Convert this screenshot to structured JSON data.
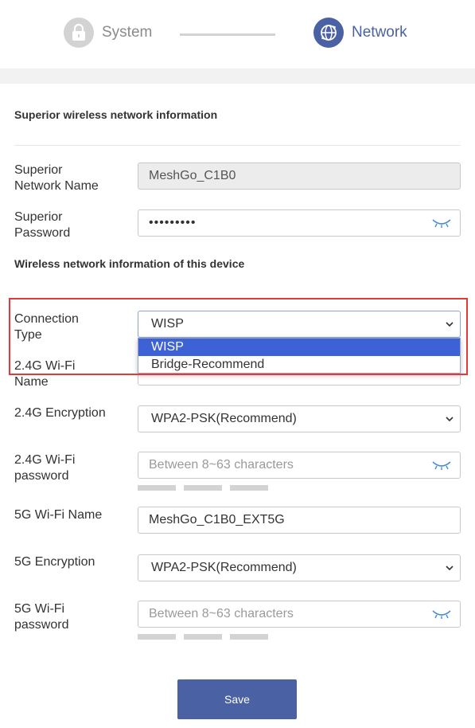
{
  "stepper": {
    "step1_label": "System",
    "step1_icon": "lock-icon",
    "step2_label": "Network",
    "step2_icon": "globe-network-icon",
    "active_color": "#4a62a4",
    "inactive_color": "#d3d3d3"
  },
  "superior": {
    "section_title": "Superior wireless network information",
    "network_name_label_1": "Superior",
    "network_name_label_2": "Network Name",
    "network_name_value": "MeshGo_C1B0",
    "password_label_1": "Superior",
    "password_label_2": "Password",
    "password_value": "•••••••••"
  },
  "device": {
    "section_title": "Wireless network information of this device",
    "connection_type_label_1": "Connection",
    "connection_type_label_2": "Type",
    "connection_type_value": "WISP",
    "connection_type_options": [
      "WISP",
      "Bridge-Recommend"
    ],
    "wifi24_name_label_1": "2.4G Wi-Fi",
    "wifi24_name_label_2": "Name",
    "wifi24_encryption_label": "2.4G Encryption",
    "wifi24_encryption_value": "WPA2-PSK(Recommend)",
    "wifi24_password_label_1": "2.4G Wi-Fi",
    "wifi24_password_label_2": "password",
    "wifi24_password_placeholder": "Between 8~63 characters",
    "wifi5_name_label": "5G Wi-Fi Name",
    "wifi5_name_value": "MeshGo_C1B0_EXT5G",
    "wifi5_encryption_label": "5G Encryption",
    "wifi5_encryption_value": "WPA2-PSK(Recommend)",
    "wifi5_password_label_1": "5G Wi-Fi",
    "wifi5_password_label_2": "password",
    "wifi5_password_placeholder": "Between 8~63 characters"
  },
  "save_label": "Save",
  "highlight_color": "#e53935"
}
